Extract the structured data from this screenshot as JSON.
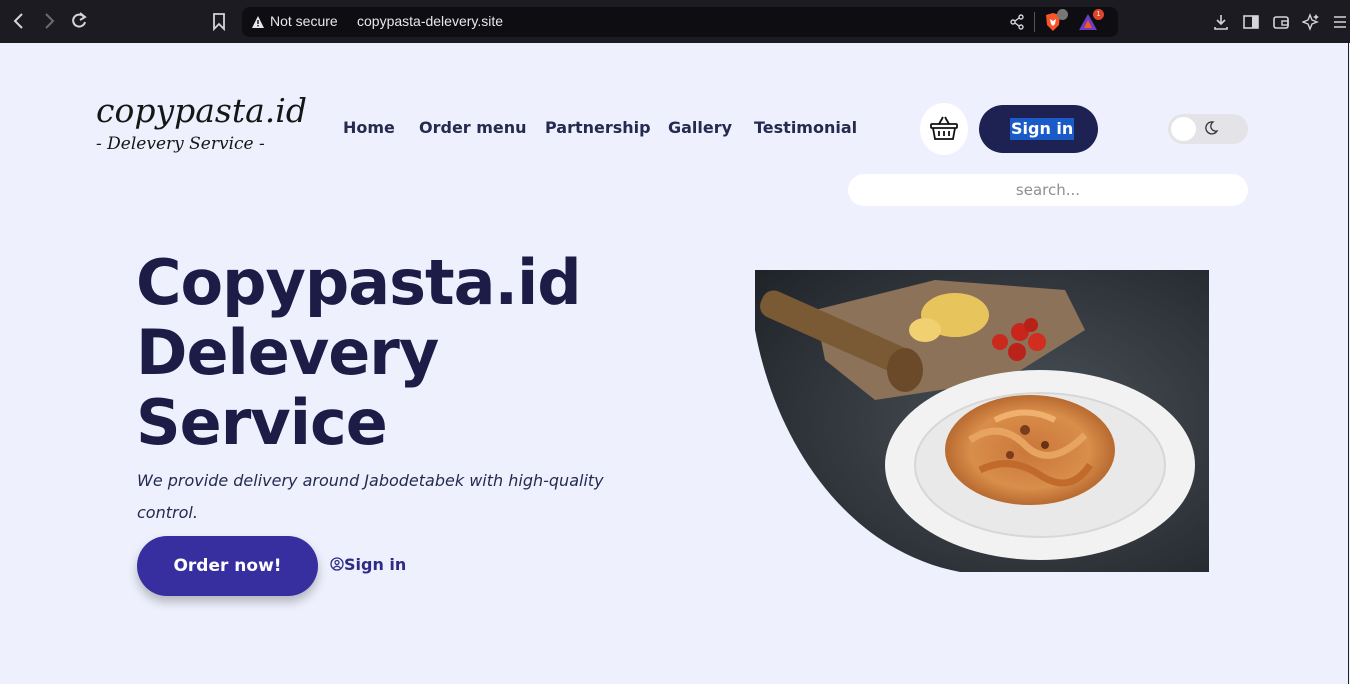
{
  "browser": {
    "security_label": "Not secure",
    "url": "copypasta-delevery.site",
    "extension_badge_1": "",
    "extension_badge_2": "1"
  },
  "logo": {
    "title": "copypasta.id",
    "subtitle": "- Delevery Service -"
  },
  "nav": {
    "items": [
      {
        "label": "Home"
      },
      {
        "label": "Order menu"
      },
      {
        "label": "Partnership"
      },
      {
        "label": "Gallery"
      },
      {
        "label": "Testimonial"
      }
    ],
    "signin_label": "Sign in"
  },
  "search": {
    "placeholder": "search..."
  },
  "hero": {
    "line1": "Copypasta.id",
    "line2": "Delevery",
    "line3": "Service",
    "tagline": "We provide delivery around Jabodetabek with high-quality control.",
    "order_button": "Order now!",
    "signin_link": "Sign in"
  },
  "colors": {
    "page_bg": "#eef1fd",
    "primary_dark": "#1e2253",
    "accent": "#372fa0",
    "heading": "#1c1c47"
  },
  "icons": [
    "back-icon",
    "forward-icon",
    "reload-icon",
    "bookmark-icon",
    "warning-icon",
    "share-icon",
    "brave-shield-icon",
    "brave-rewards-icon",
    "download-icon",
    "sidebar-icon",
    "wallet-icon",
    "leo-icon",
    "menu-icon",
    "basket-icon",
    "moon-icon",
    "user-circle-icon"
  ]
}
